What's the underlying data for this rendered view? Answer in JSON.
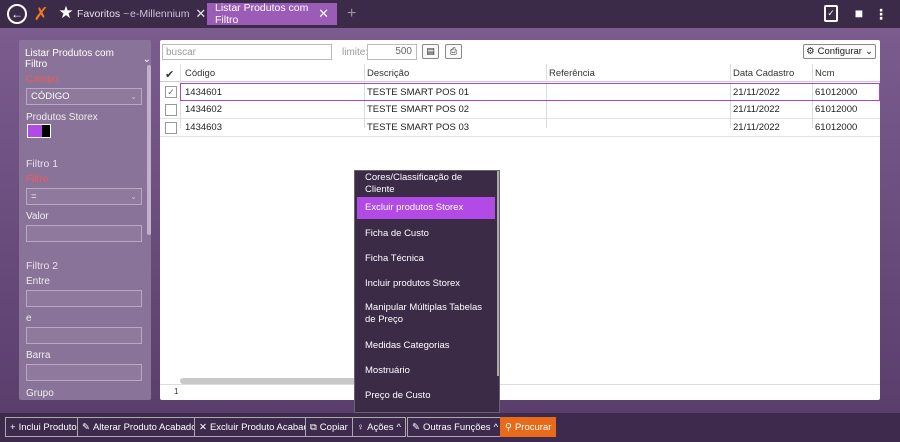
{
  "topbar": {
    "tabs": [
      {
        "label": "Favoritos",
        "suffix": "~"
      },
      {
        "label": "e-Millennium"
      },
      {
        "label": "Listar Produtos com Filtro"
      }
    ],
    "add_tab": "+"
  },
  "filter_panel": {
    "title": "Listar Produtos com Filtro",
    "campo_label": "Campo",
    "campo_value": "CÓDIGO",
    "produtos_storex_label": "Produtos Storex",
    "filtro1_title": "Filtro 1",
    "filtro_label": "Filtro",
    "filtro_value": "=",
    "valor_label": "Valor",
    "filtro2_title": "Filtro 2",
    "entre_label": "Entre",
    "e_label": "e",
    "barra_label": "Barra",
    "grupo_label": "Grupo"
  },
  "grid": {
    "search_placeholder": "buscar",
    "limit_label": "limite:",
    "limit_value": "500",
    "configure_label": "Configurar",
    "columns": [
      "Código",
      "Descrição",
      "Referência",
      "Data Cadastro",
      "Ncm"
    ],
    "rows": [
      {
        "checked": true,
        "codigo": "1434601",
        "descricao": "TESTE SMART POS 01",
        "referencia": "",
        "data": "21/11/2022",
        "ncm": "61012000"
      },
      {
        "checked": false,
        "codigo": "1434602",
        "descricao": "TESTE SMART POS 02",
        "referencia": "",
        "data": "21/11/2022",
        "ncm": "61012000"
      },
      {
        "checked": false,
        "codigo": "1434603",
        "descricao": "TESTE SMART POS 03",
        "referencia": "",
        "data": "21/11/2022",
        "ncm": "61012000"
      }
    ],
    "footer_count": "1"
  },
  "actions_menu": {
    "items": [
      "Cores/Classificação de Cliente",
      "Excluir produtos Storex",
      "Ficha de Custo",
      "Ficha Técnica",
      "Incluir produtos Storex",
      "Manipular Múltiplas Tabelas de Preço",
      "Medidas Categorias",
      "Mostruário",
      "Preço de Custo"
    ],
    "highlighted_index": 1
  },
  "bottombar": {
    "inclui": "Inclui Produto",
    "alterar": "Alterar Produto Acabado",
    "excluir": "Excluir Produto Acabado",
    "copiar": "Copiar",
    "acoes": "Ações",
    "outras": "Outras Funções",
    "procurar": "Procurar"
  },
  "colors": {
    "accent": "#9b5cb8",
    "highlight": "#b24be6",
    "search_button": "#e86b1a",
    "storex_color": "#b24be6"
  }
}
